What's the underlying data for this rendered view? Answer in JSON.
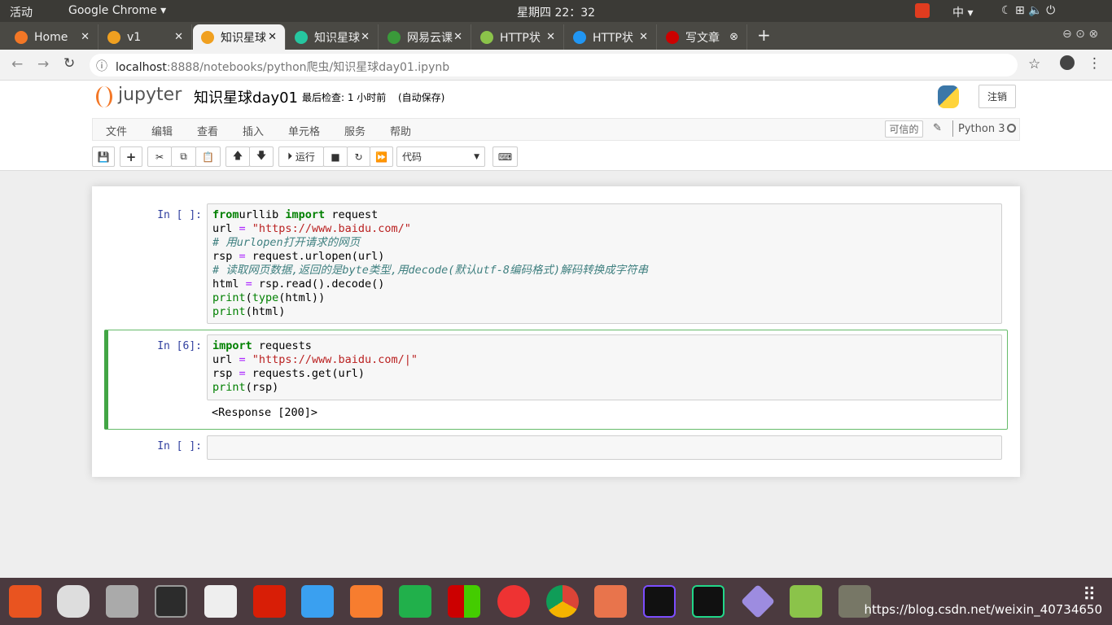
{
  "system": {
    "activities": "活动",
    "app": "Google Chrome ▾",
    "clock": "星期四 22：32",
    "ime": "中 ▾"
  },
  "tabs": [
    {
      "label": "Home",
      "color": "#f37726"
    },
    {
      "label": "v1",
      "color": "#f0a020"
    },
    {
      "label": "知识星球",
      "color": "#f0a020",
      "active": true
    },
    {
      "label": "知识星球",
      "color": "#26c6a0"
    },
    {
      "label": "网易云课",
      "color": "#3a9a3a"
    },
    {
      "label": "HTTP状",
      "color": "#8bc34a"
    },
    {
      "label": "HTTP状",
      "color": "#2196f3"
    },
    {
      "label": "写文章",
      "color": "#cc0000"
    }
  ],
  "address": {
    "host": "localhost",
    "path": ":8888/notebooks/python爬虫/知识星球day01.ipynb"
  },
  "jupyter": {
    "logo": "jupyter",
    "title": "知识星球day01",
    "checkpoint": "最后检查: 1 小时前",
    "autosave": "(自动保存)",
    "logout": "注销",
    "trusted": "可信的",
    "kernel": "Python 3"
  },
  "menu": [
    "文件",
    "编辑",
    "查看",
    "插入",
    "单元格",
    "服务",
    "帮助"
  ],
  "toolbar": {
    "run": "运行",
    "cell_type": "代码"
  },
  "cells": [
    {
      "prompt": "In [ ]:",
      "lines": [
        [
          [
            "kw",
            "from"
          ],
          [
            "",
            "urllib "
          ],
          [
            "kw",
            "import"
          ],
          [
            "",
            " request"
          ]
        ],
        [
          [
            "",
            "url "
          ],
          [
            "op",
            "="
          ],
          [
            "",
            " "
          ],
          [
            "str",
            "\"https://www.baidu.com/\""
          ]
        ],
        [
          [
            "cm",
            "# 用urlopen打开请求的网页"
          ]
        ],
        [
          [
            "",
            "rsp "
          ],
          [
            "op",
            "="
          ],
          [
            "",
            " request.urlopen(url)"
          ]
        ],
        [
          [
            "cm",
            "# 读取网页数据,返回的是byte类型,用decode(默认utf-8编码格式)解码转换成字符串"
          ]
        ],
        [
          [
            "",
            "html "
          ],
          [
            "op",
            "="
          ],
          [
            "",
            " rsp.read().decode()"
          ]
        ],
        [
          [
            "bi",
            "print"
          ],
          [
            "",
            "("
          ],
          [
            "bi",
            "type"
          ],
          [
            "",
            "(html))"
          ]
        ],
        [
          [
            "bi",
            "print"
          ],
          [
            "",
            "(html)"
          ]
        ]
      ]
    },
    {
      "prompt": "In [6]:",
      "lines": [
        [
          [
            "kw",
            "import"
          ],
          [
            "",
            " requests"
          ]
        ],
        [
          [
            "",
            "url "
          ],
          [
            "op",
            "="
          ],
          [
            "",
            " "
          ],
          [
            "str",
            "\"https://www.baidu.com/|\""
          ]
        ],
        [
          [
            "",
            "rsp "
          ],
          [
            "op",
            "="
          ],
          [
            "",
            " requests.get(url)"
          ]
        ],
        [
          [
            "bi",
            "print"
          ],
          [
            "",
            "(rsp)"
          ]
        ]
      ],
      "output": "<Response [200]>"
    },
    {
      "prompt": "In [ ]:",
      "lines": []
    }
  ],
  "watermark": "https://blog.csdn.net/weixin_40734650"
}
